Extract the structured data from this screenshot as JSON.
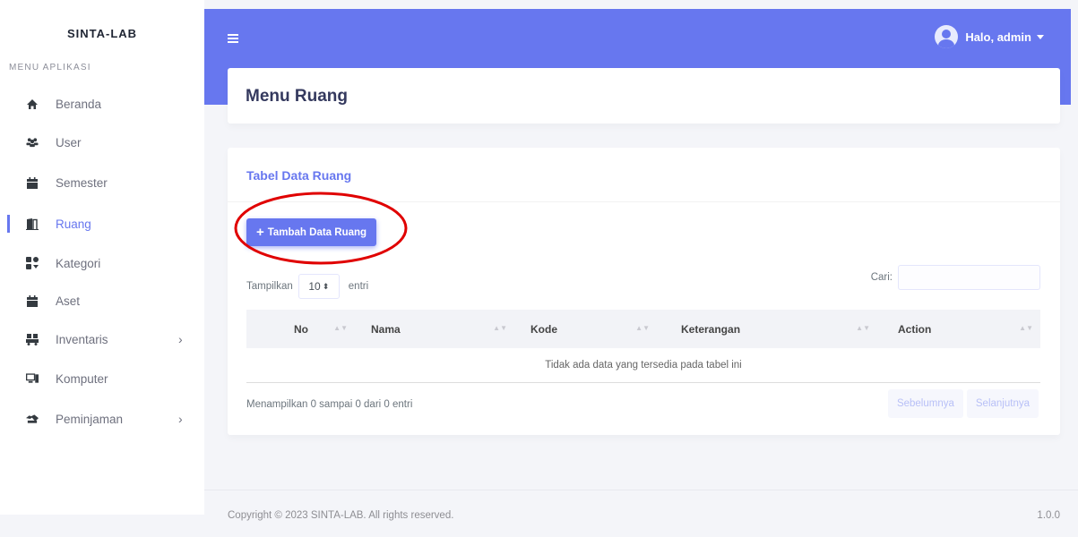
{
  "sidebar": {
    "brand": "SINTA-LAB",
    "heading": "MENU APLIKASI",
    "items": [
      {
        "label": "Beranda",
        "icon": "home-icon"
      },
      {
        "label": "User",
        "icon": "users-icon"
      },
      {
        "label": "Semester",
        "icon": "calendar-icon"
      },
      {
        "label": "Ruang",
        "icon": "door-icon",
        "active": true
      },
      {
        "label": "Kategori",
        "icon": "tags-icon"
      },
      {
        "label": "Aset",
        "icon": "box-icon"
      },
      {
        "label": "Inventaris",
        "icon": "dolly-icon",
        "has_submenu": true
      },
      {
        "label": "Komputer",
        "icon": "computer-icon"
      },
      {
        "label": "Peminjaman",
        "icon": "handshake-icon",
        "has_submenu": true
      }
    ],
    "chevron": "›"
  },
  "topbar": {
    "user_label": "Halo, admin",
    "accent_color": "#6777ef"
  },
  "page": {
    "title": "Menu Ruang"
  },
  "card": {
    "title": "Tabel Data Ruang",
    "add_button_label": "Tambah Data Ruang",
    "length_prefix": "Tampilkan",
    "length_value": "10",
    "length_suffix": "entri",
    "search_label": "Cari:",
    "search_value": "",
    "columns": [
      "No",
      "Nama",
      "Kode",
      "Keterangan",
      "Action"
    ],
    "empty_message": "Tidak ada data yang tersedia pada tabel ini",
    "info": "Menampilkan 0 sampai 0 dari 0 entri",
    "prev_label": "Sebelumnya",
    "next_label": "Selanjutnya"
  },
  "footer": {
    "copyright": "Copyright © 2023 SINTA-LAB. All rights reserved.",
    "version": "1.0.0"
  }
}
